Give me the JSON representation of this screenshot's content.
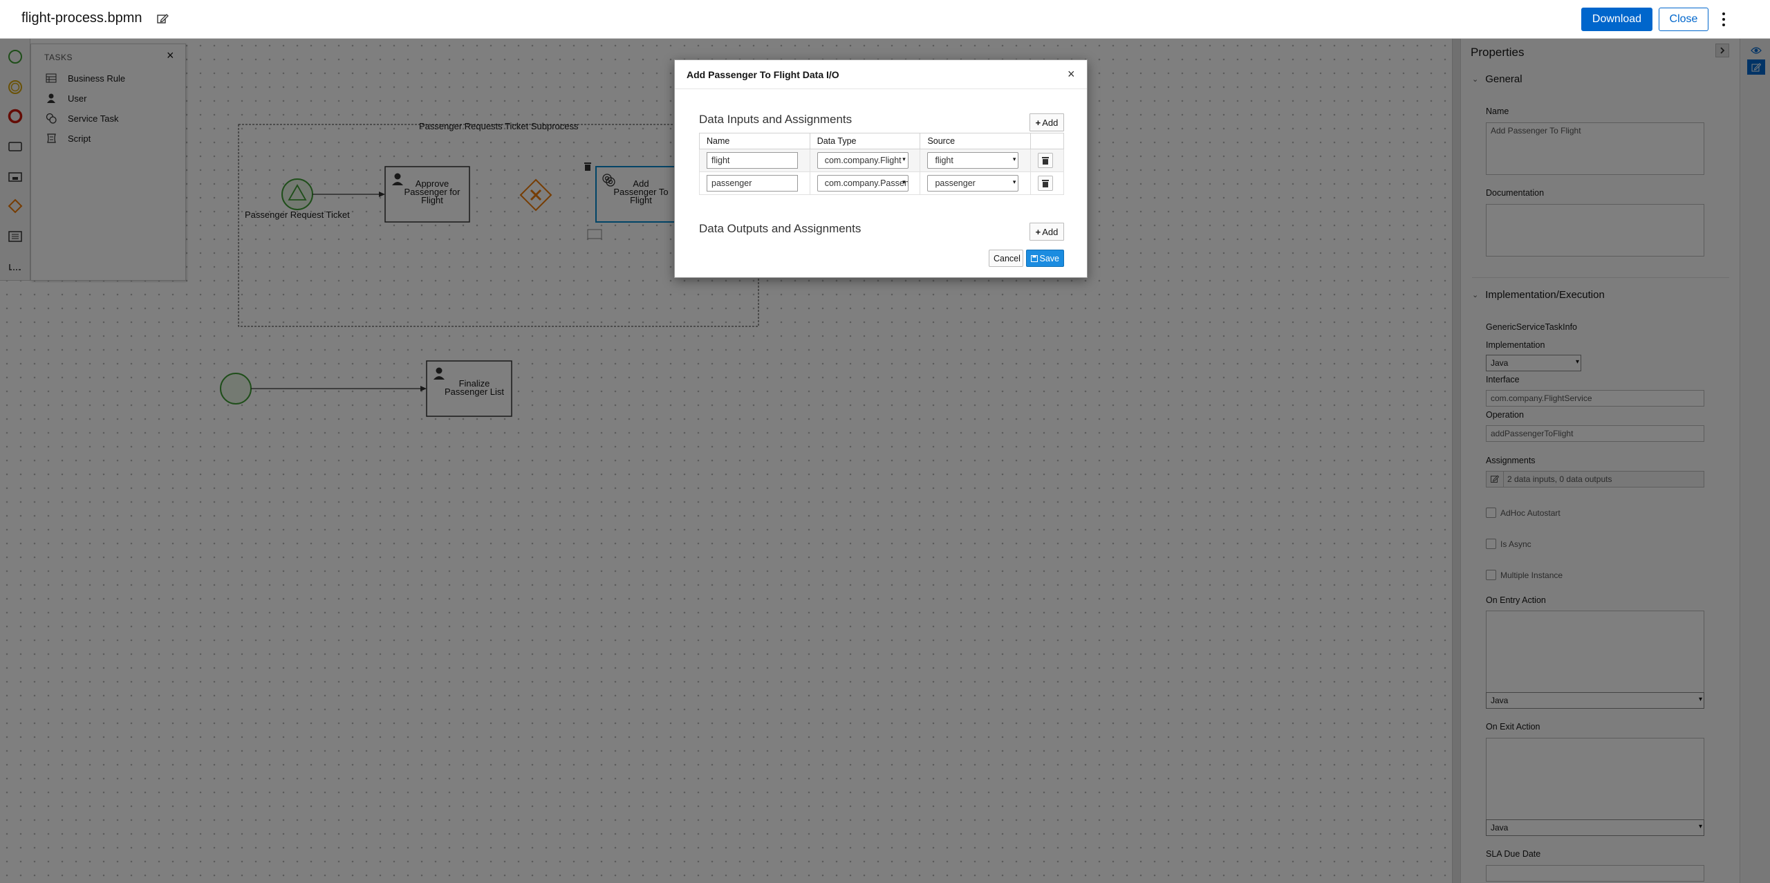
{
  "header": {
    "file_name": "flight-process.bpmn",
    "download_label": "Download",
    "close_label": "Close"
  },
  "palette": {
    "items": [
      "start-events",
      "intermediate-events",
      "end-events",
      "activities",
      "subprocesses",
      "gateways",
      "containers",
      "artifacts"
    ]
  },
  "tasks_flyout": {
    "title": "TASKS",
    "items": [
      "Business Rule",
      "User",
      "Service Task",
      "Script"
    ]
  },
  "diagram": {
    "subprocess_title": "Passenger Requests Ticket Subprocess",
    "start_event_label": "Passenger Request Ticket",
    "task_approve": [
      "Approve",
      "Passenger for",
      "Flight"
    ],
    "task_add": [
      "Add",
      "Passenger To",
      "Flight"
    ],
    "task_finalize": [
      "Finalize",
      "Passenger List"
    ],
    "colors": {
      "start_event": "#3f9c35",
      "gateway": "#ec7a08",
      "selected": "#0088ce"
    }
  },
  "modal": {
    "title": "Add Passenger To Flight Data I/O",
    "inputs_title": "Data Inputs and Assignments",
    "outputs_title": "Data Outputs and Assignments",
    "add_label": "Add",
    "columns": [
      "Name",
      "Data Type",
      "Source"
    ],
    "rows": [
      {
        "name": "flight",
        "data_type": "com.company.Flight",
        "source": "flight"
      },
      {
        "name": "passenger",
        "data_type": "com.company.Passenger",
        "source": "passenger"
      }
    ],
    "cancel_label": "Cancel",
    "save_label": "Save"
  },
  "properties": {
    "title": "Properties",
    "general": {
      "heading": "General",
      "name_label": "Name",
      "name_value": "Add Passenger To Flight",
      "documentation_label": "Documentation"
    },
    "implementation": {
      "heading": "Implementation/Execution",
      "info_label": "GenericServiceTaskInfo",
      "implementation_label": "Implementation",
      "implementation_value": "Java",
      "interface_label": "Interface",
      "interface_value": "com.company.FlightService",
      "operation_label": "Operation",
      "operation_value": "addPassengerToFlight",
      "assignments_label": "Assignments",
      "assignments_value": "2 data inputs, 0 data outputs",
      "adhoc_label": "AdHoc Autostart",
      "async_label": "Is Async",
      "multiple_label": "Multiple Instance",
      "on_entry_label": "On Entry Action",
      "on_entry_lang": "Java",
      "on_exit_label": "On Exit Action",
      "on_exit_lang": "Java",
      "sla_label": "SLA Due Date"
    }
  }
}
